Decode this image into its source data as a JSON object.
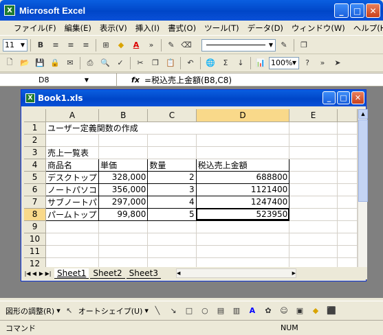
{
  "app": {
    "title": "Microsoft Excel"
  },
  "menubar": [
    "ファイル(F)",
    "編集(E)",
    "表示(V)",
    "挿入(I)",
    "書式(O)",
    "ツール(T)",
    "データ(D)",
    "ウィンドウ(W)",
    "ヘルプ(H)"
  ],
  "toolbar1": {
    "font_size": "11",
    "bold": "B"
  },
  "toolbar2": {
    "zoom": "100%"
  },
  "formula_bar": {
    "name_box": "D8",
    "fx": "fx",
    "formula": "=税込売上金額(B8,C8)"
  },
  "workbook": {
    "title": "Book1.xls",
    "columns": [
      "A",
      "B",
      "C",
      "D",
      "E"
    ],
    "rows": [
      "1",
      "2",
      "3",
      "4",
      "5",
      "6",
      "7",
      "8",
      "9",
      "10",
      "11",
      "12"
    ],
    "cells": {
      "A1": "ユーザー定義関数の作成",
      "A3": "売上一覧表",
      "A4": "商品名",
      "B4": "単価",
      "C4": "数量",
      "D4": "税込売上金額",
      "A5": "デスクトップ",
      "B5": "328,000",
      "C5": "2",
      "D5": "688800",
      "A6": "ノートパソコ",
      "B6": "356,000",
      "C6": "3",
      "D6": "1121400",
      "A7": "サブノートパ",
      "B7": "297,000",
      "C7": "4",
      "D7": "1247400",
      "A8": "パームトップ",
      "B8": "99,800",
      "C8": "5",
      "D8": "523950"
    },
    "sheets": [
      "Sheet1",
      "Sheet2",
      "Sheet3"
    ],
    "active_sheet": "Sheet1"
  },
  "drawbar": {
    "draw_label": "図形の調整(R)",
    "autoshape_label": "オートシェイプ(U)"
  },
  "statusbar": {
    "mode": "コマンド",
    "num": "NUM"
  }
}
